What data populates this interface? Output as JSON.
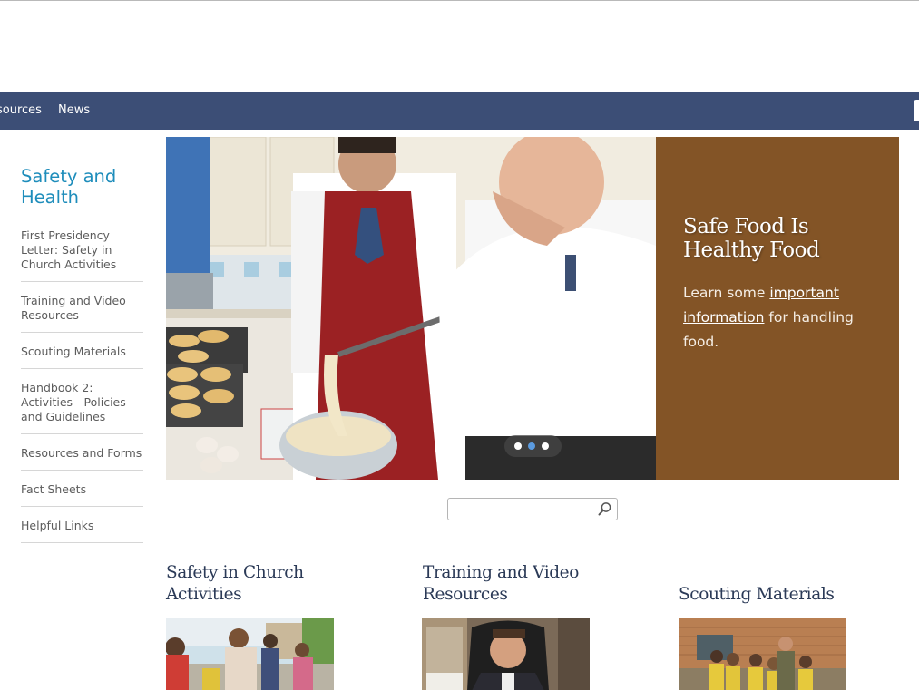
{
  "nav": {
    "items": [
      {
        "label": "sources"
      },
      {
        "label": "News"
      }
    ]
  },
  "sidebar": {
    "title": "Safety and Health",
    "links": [
      {
        "label": "First Presidency Letter: Safety in Church Activities"
      },
      {
        "label": "Training and Video Resources"
      },
      {
        "label": "Scouting Materials"
      },
      {
        "label": "Handbook 2: Activities—Policies and Guidelines"
      },
      {
        "label": "Resources and Forms"
      },
      {
        "label": "Fact Sheets"
      },
      {
        "label": "Helpful Links"
      }
    ]
  },
  "hero": {
    "title": "Safe Food Is Healthy Food",
    "text_before": "Learn some ",
    "link_text": "important information",
    "text_after": " for handling food.",
    "panel_color": "#835426",
    "slides": 3,
    "active_slide": 2
  },
  "search": {
    "value": "",
    "placeholder": ""
  },
  "cards": [
    {
      "title": "Safety in Church Activities"
    },
    {
      "title": "Training and Video Resources"
    },
    {
      "title": "Scouting Materials"
    }
  ],
  "colors": {
    "navbar": "#3c4e76",
    "sidebar_title": "#1e8dbb",
    "card_title": "#2b3a57"
  }
}
